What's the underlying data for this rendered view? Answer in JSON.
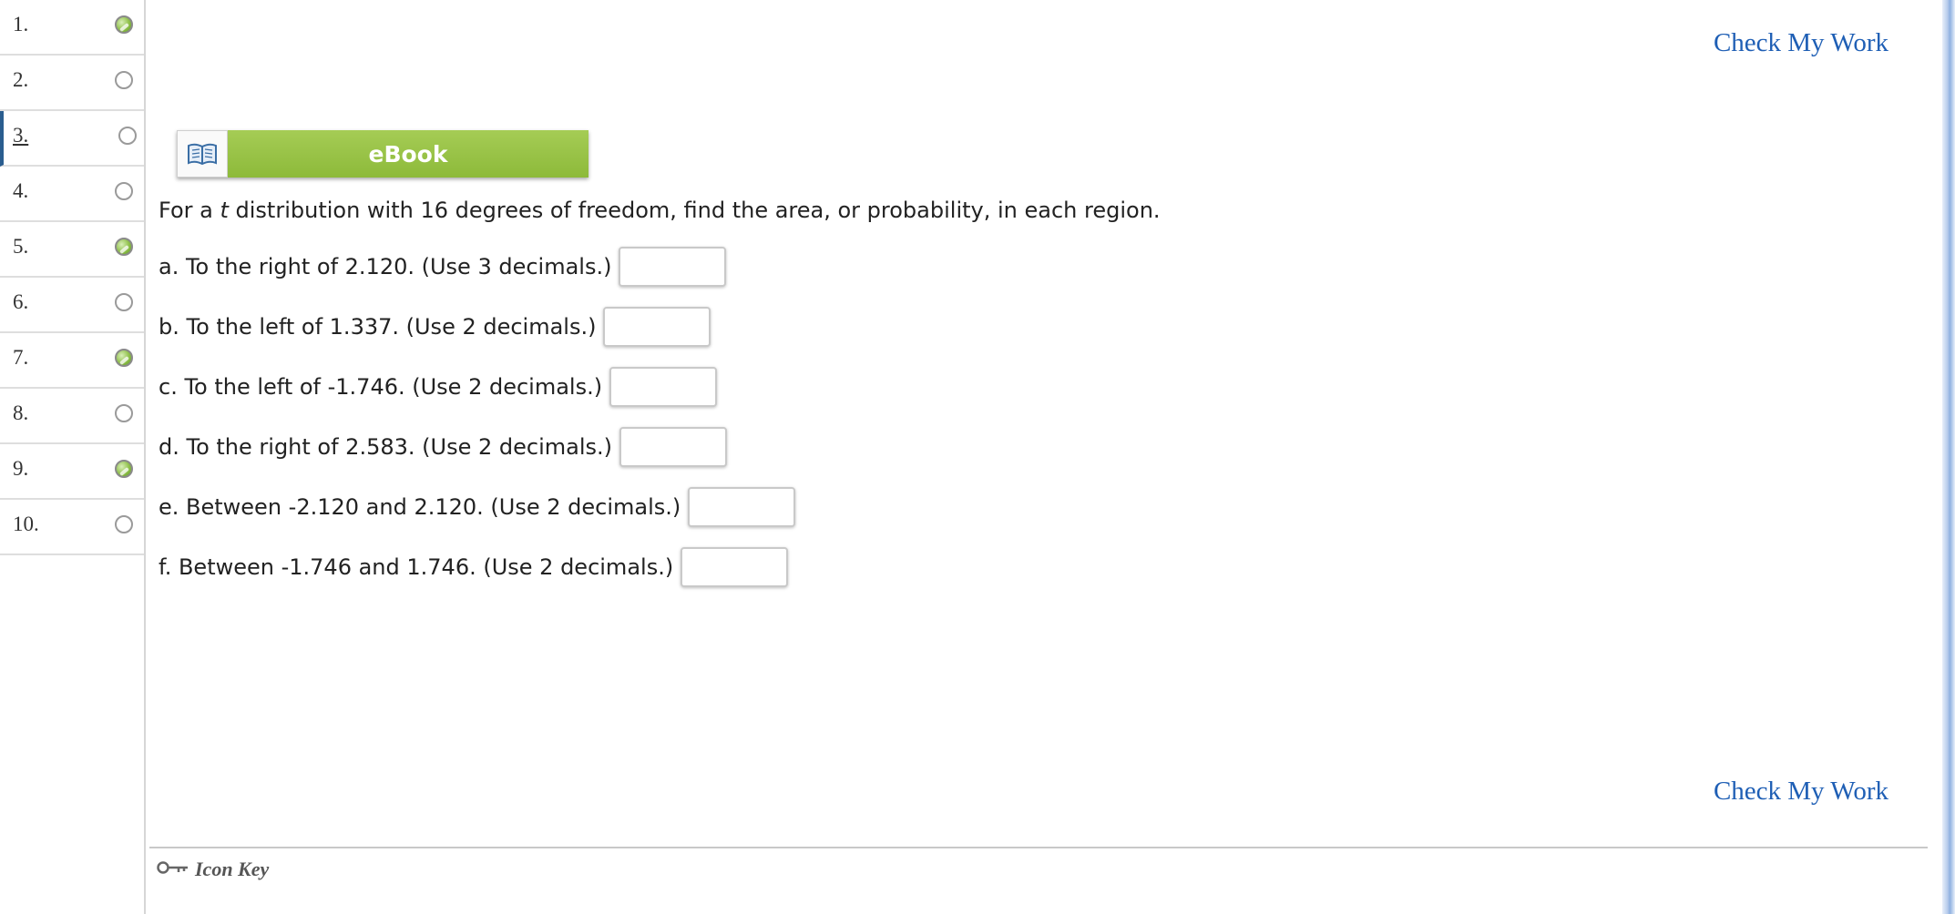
{
  "questions": [
    {
      "number": "1.",
      "status": "done"
    },
    {
      "number": "2.",
      "status": "empty"
    },
    {
      "number": "3.",
      "status": "empty",
      "active": true
    },
    {
      "number": "4.",
      "status": "empty"
    },
    {
      "number": "5.",
      "status": "done"
    },
    {
      "number": "6.",
      "status": "empty"
    },
    {
      "number": "7.",
      "status": "done"
    },
    {
      "number": "8.",
      "status": "empty"
    },
    {
      "number": "9.",
      "status": "done"
    },
    {
      "number": "10.",
      "status": "empty"
    }
  ],
  "check_my_work": "Check My Work",
  "ebook": {
    "label": "eBook",
    "icon": "book-icon"
  },
  "prompt": {
    "before": "For a ",
    "italic": "t",
    "after": " distribution with 16 degrees of freedom, find the area, or probability, in each region."
  },
  "parts": [
    {
      "text": "a. To the right of 2.120. (Use 3 decimals.)",
      "value": ""
    },
    {
      "text": "b. To the left of 1.337. (Use 2 decimals.)",
      "value": ""
    },
    {
      "text": "c. To the left of -1.746. (Use 2 decimals.)",
      "value": ""
    },
    {
      "text": "d. To the right of 2.583. (Use 2 decimals.)",
      "value": ""
    },
    {
      "text": "e. Between -2.120 and 2.120. (Use 2 decimals.)",
      "value": ""
    },
    {
      "text": "f. Between -1.746 and 1.746. (Use 2 decimals.)",
      "value": ""
    }
  ],
  "icon_key": {
    "label": "Icon Key",
    "icon": "key-icon"
  },
  "colors": {
    "link": "#1f5fb5",
    "ebook_green": "#8dba3a",
    "active_marker": "#2a5d8f"
  }
}
